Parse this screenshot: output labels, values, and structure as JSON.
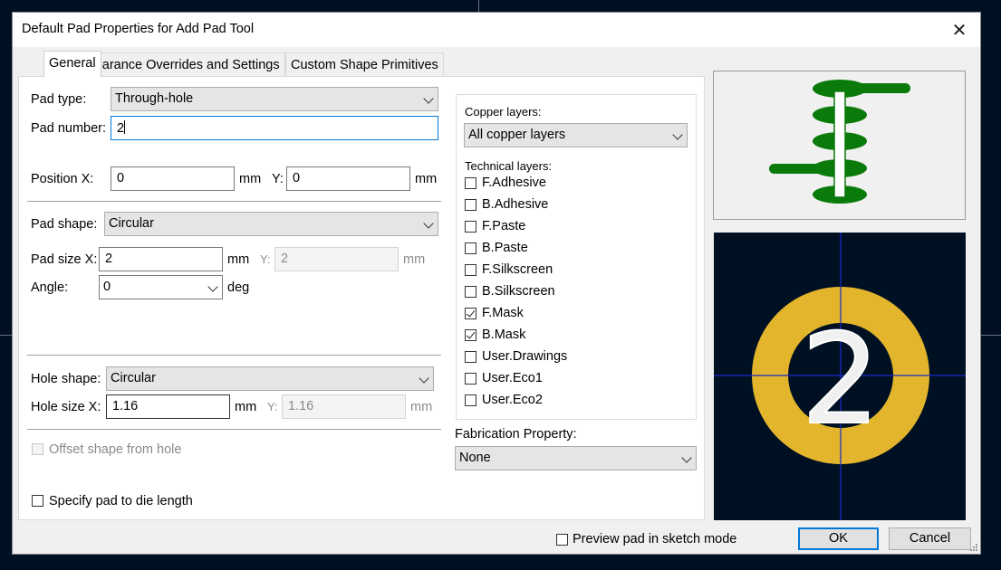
{
  "dialog": {
    "title": "Default Pad Properties for Add Pad Tool",
    "close_glyph": "✕"
  },
  "tabs": [
    {
      "label": "General",
      "active": true
    },
    {
      "label": "Clearance Overrides and Settings",
      "active": false
    },
    {
      "label": "Custom Shape Primitives",
      "active": false
    }
  ],
  "general": {
    "pad_type_label": "Pad type:",
    "pad_type_value": "Through-hole",
    "pad_number_label": "Pad number:",
    "pad_number_value": "2",
    "position_x_label": "Position X:",
    "position_x_value": "0",
    "position_x_unit": "mm",
    "position_y_label": "Y:",
    "position_y_value": "0",
    "position_y_unit": "mm",
    "pad_shape_label": "Pad shape:",
    "pad_shape_value": "Circular",
    "pad_size_x_label": "Pad size X:",
    "pad_size_x_value": "2",
    "pad_size_x_unit": "mm",
    "pad_size_y_label": "Y:",
    "pad_size_y_value": "2",
    "pad_size_y_unit": "mm",
    "angle_label": "Angle:",
    "angle_value": "0",
    "angle_unit": "deg",
    "hole_shape_label": "Hole shape:",
    "hole_shape_value": "Circular",
    "hole_size_x_label": "Hole size X:",
    "hole_size_x_value": "1.16",
    "hole_size_x_unit": "mm",
    "hole_size_y_label": "Y:",
    "hole_size_y_value": "1.16",
    "hole_size_y_unit": "mm",
    "offset_label": "Offset shape from hole",
    "offset_checked": false,
    "die_length_label": "Specify pad to die length",
    "die_length_checked": false
  },
  "layers": {
    "copper_label": "Copper layers:",
    "copper_value": "All copper layers",
    "technical_label": "Technical layers:",
    "technical": [
      {
        "name": "F.Adhesive",
        "checked": false
      },
      {
        "name": "B.Adhesive",
        "checked": false
      },
      {
        "name": "F.Paste",
        "checked": false
      },
      {
        "name": "B.Paste",
        "checked": false
      },
      {
        "name": "F.Silkscreen",
        "checked": false
      },
      {
        "name": "B.Silkscreen",
        "checked": false
      },
      {
        "name": "F.Mask",
        "checked": true
      },
      {
        "name": "B.Mask",
        "checked": true
      },
      {
        "name": "User.Drawings",
        "checked": false
      },
      {
        "name": "User.Eco1",
        "checked": false
      },
      {
        "name": "User.Eco2",
        "checked": false
      }
    ],
    "fabrication_label": "Fabrication Property:",
    "fabrication_value": "None"
  },
  "preview": {
    "pad_label": "2",
    "sketch_mode_label": "Preview pad in sketch mode",
    "sketch_mode_checked": false,
    "colors": {
      "pad": "#e2b52c",
      "copper_layers": "#0a7a0a",
      "board_bg": "#001023",
      "crosshair": "#1a28c8"
    }
  },
  "buttons": {
    "ok": "OK",
    "cancel": "Cancel"
  }
}
